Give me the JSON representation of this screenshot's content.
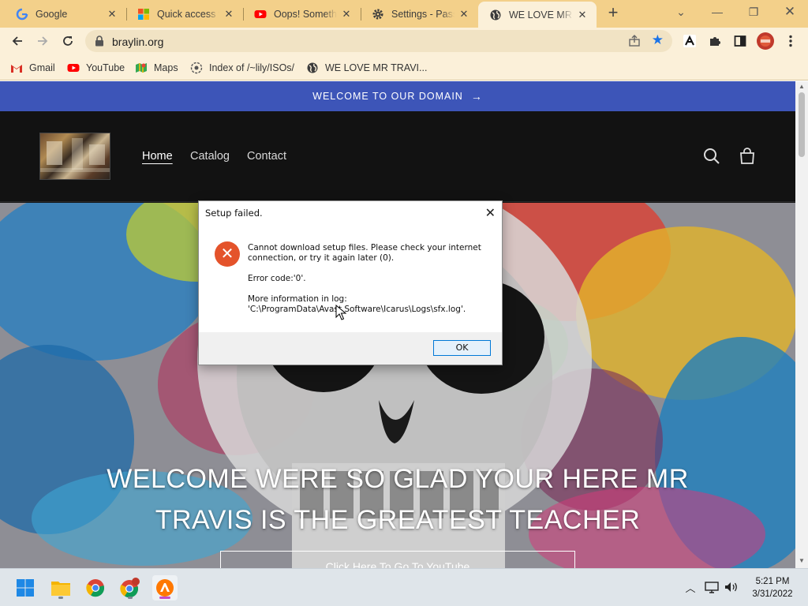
{
  "browser": {
    "tabs": [
      {
        "title": "Google",
        "icon": "google-icon",
        "active": false
      },
      {
        "title": "Quick access to",
        "icon": "microsoft-icon",
        "active": false
      },
      {
        "title": "Oops! Somethin",
        "icon": "youtube-icon",
        "active": false
      },
      {
        "title": "Settings - Passw",
        "icon": "settings-gear-icon",
        "active": false
      },
      {
        "title": "WE LOVE MR TR",
        "icon": "globe-icon",
        "active": true
      }
    ],
    "new_tab_label": "+",
    "url": "braylin.org",
    "bookmarks": [
      {
        "label": "Gmail",
        "icon": "gmail-icon"
      },
      {
        "label": "YouTube",
        "icon": "youtube-icon"
      },
      {
        "label": "Maps",
        "icon": "maps-icon"
      },
      {
        "label": "Index of /~lily/ISOs/",
        "icon": "web-icon"
      },
      {
        "label": "WE LOVE MR TRAVI...",
        "icon": "globe-icon"
      }
    ],
    "colors": {
      "frame": "#f3d08a",
      "toolbar": "#fbf0d9",
      "star": "#1a73e8"
    }
  },
  "site": {
    "announcement": "WELCOME TO OUR DOMAIN",
    "nav": [
      "Home",
      "Catalog",
      "Contact"
    ],
    "hero_title_line1": "WELCOME WERE SO GLAD YOUR HERE MR",
    "hero_title_line2": "TRAVIS IS THE GREATEST TEACHER",
    "hero_button": "Click Here To Go To YouTube",
    "colors": {
      "announcement_bg": "#3d55b8",
      "header_bg": "#121212"
    }
  },
  "dialog": {
    "title": "Setup failed.",
    "message": "Cannot download setup files. Please check your internet connection, or try it again later (0).",
    "error_code": "Error code:'0'.",
    "log_label": "More information in log:",
    "log_path": "'C:\\ProgramData\\Avast Software\\Icarus\\Logs\\sfx.log'.",
    "ok_label": "OK",
    "icon_color": "#e4532b"
  },
  "taskbar": {
    "apps": [
      "windows-start-icon",
      "file-explorer-icon",
      "chrome-icon",
      "chrome-profile-icon",
      "avast-icon"
    ],
    "time": "5:21 PM",
    "date": "3/31/2022"
  }
}
